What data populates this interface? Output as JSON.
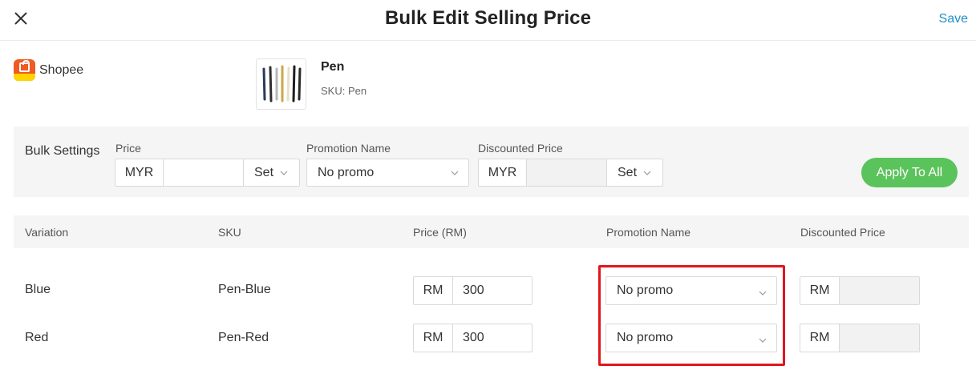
{
  "header": {
    "title": "Bulk Edit Selling Price",
    "save_label": "Save",
    "close_icon": "close-icon"
  },
  "store": {
    "name": "Shopee",
    "brand_color": "#f05a23"
  },
  "product": {
    "name": "Pen",
    "sku": "SKU: Pen"
  },
  "bulk": {
    "label": "Bulk Settings",
    "price_label": "Price",
    "price_currency": "MYR",
    "price_value": "",
    "price_mode": "Set",
    "promo_label": "Promotion Name",
    "promo_value": "No promo",
    "discount_label": "Discounted Price",
    "discount_currency": "MYR",
    "discount_value": "",
    "discount_mode": "Set",
    "apply_label": "Apply To All"
  },
  "table": {
    "columns": [
      "Variation",
      "SKU",
      "Price (RM)",
      "Promotion Name",
      "Discounted Price"
    ],
    "rows": [
      {
        "variation": "Blue",
        "sku": "Pen-Blue",
        "currency": "RM",
        "price": "300",
        "promo": "No promo",
        "discount_currency": "RM",
        "discount": ""
      },
      {
        "variation": "Red",
        "sku": "Pen-Red",
        "currency": "RM",
        "price": "300",
        "promo": "No promo",
        "discount_currency": "RM",
        "discount": ""
      }
    ]
  },
  "colors": {
    "accent": "#1f90c6",
    "apply": "#5bc35b",
    "highlight": "#e0161d"
  }
}
